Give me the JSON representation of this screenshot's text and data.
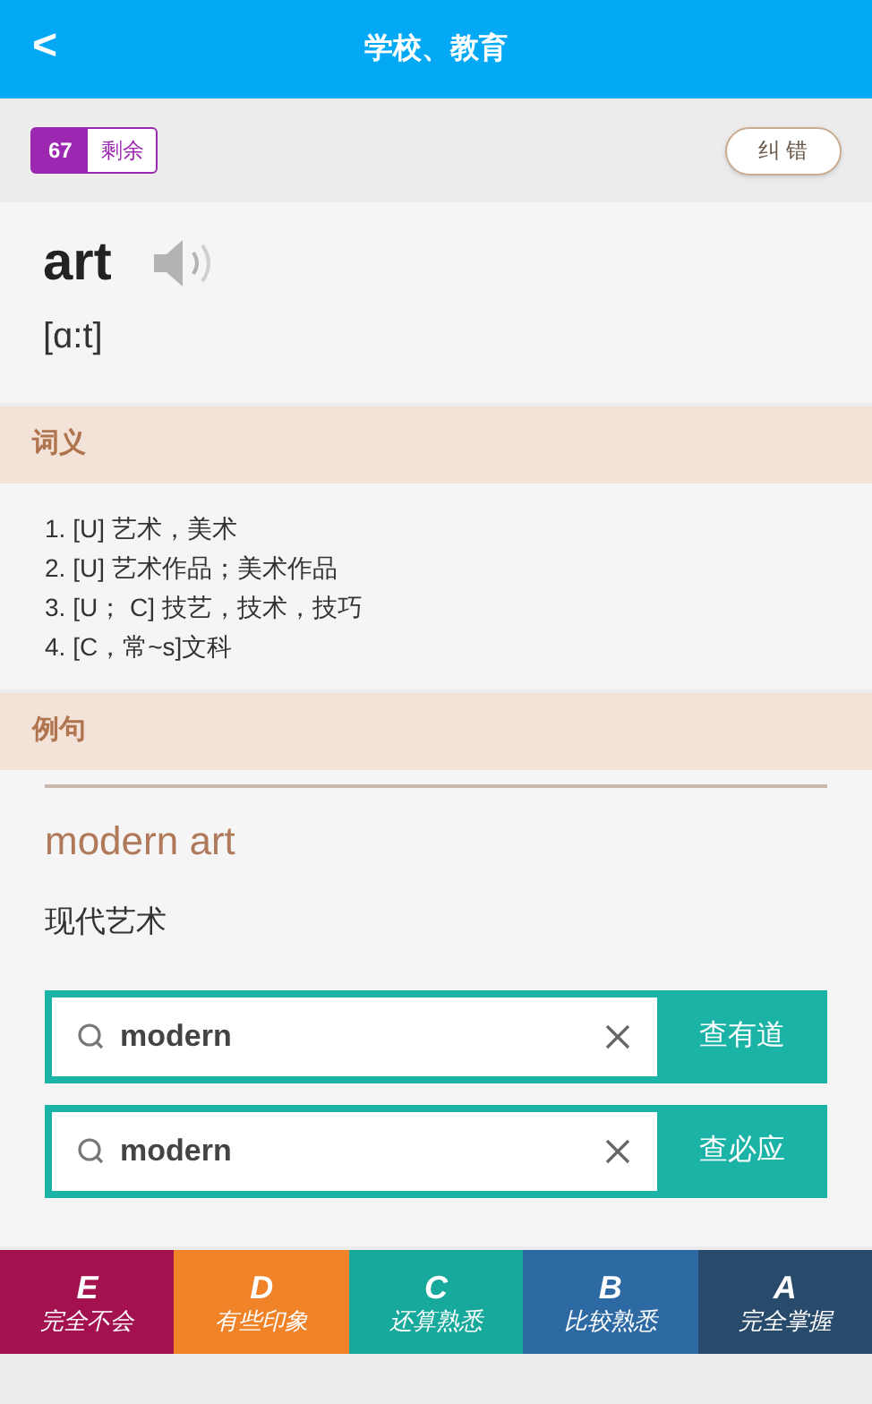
{
  "header": {
    "back": "<",
    "title": "学校、教育"
  },
  "progress": {
    "count": "67",
    "label": "剩余"
  },
  "report_button": "纠 错",
  "word": {
    "text": "art",
    "phonetic": "[ɑ:t]"
  },
  "definitions": {
    "heading": "词义",
    "items": [
      "1. [U] 艺术，美术",
      "2. [U] 艺术作品；美术作品",
      "3. [U； C] 技艺，技术，技巧",
      "4. [C，常~s]文科"
    ]
  },
  "examples": {
    "heading": "例句",
    "phrase": "modern art",
    "translation": "现代艺术"
  },
  "lookups": [
    {
      "query": "modern",
      "button": "查有道"
    },
    {
      "query": "modern",
      "button": "查必应"
    }
  ],
  "grades": [
    {
      "letter": "E",
      "label": "完全不会",
      "color": "#a3124f"
    },
    {
      "letter": "D",
      "label": "有些印象",
      "color": "#f08228"
    },
    {
      "letter": "C",
      "label": "还算熟悉",
      "color": "#17a99b"
    },
    {
      "letter": "B",
      "label": "比较熟悉",
      "color": "#2d6aa3"
    },
    {
      "letter": "A",
      "label": "完全掌握",
      "color": "#284a6b"
    }
  ]
}
